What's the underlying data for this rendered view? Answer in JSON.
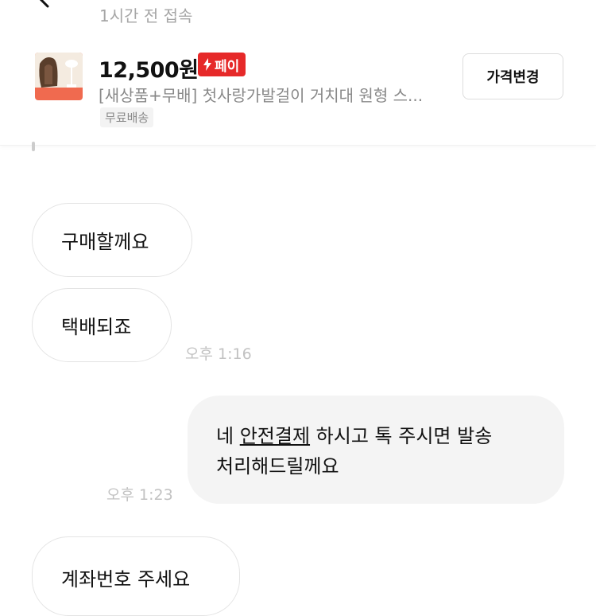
{
  "header": {
    "status": "1시간 전 접속",
    "product": {
      "price": "12,500원",
      "pay_badge": "페이",
      "title": "[새상품+무배] 첫사랑가발걸이 거치대 원형 스...",
      "shipping_tag": "무료배송",
      "change_price_button": "가격변경"
    }
  },
  "messages": [
    {
      "from": "other",
      "text": "구매할께요"
    },
    {
      "from": "other",
      "text": "택배되죠",
      "time": "오후 1:16"
    },
    {
      "from": "me",
      "prefix": "네 ",
      "link": "안전결제",
      "suffix": " 하시고 톡 주시면 발송",
      "line2": "처리해드릴께요",
      "time": "오후 1:23"
    },
    {
      "from": "other",
      "text": "계좌번호 주세요"
    }
  ],
  "colors": {
    "pay_badge": "#e62929",
    "my_bubble": "#f4f4f4",
    "timestamp": "#c2c2c2"
  }
}
